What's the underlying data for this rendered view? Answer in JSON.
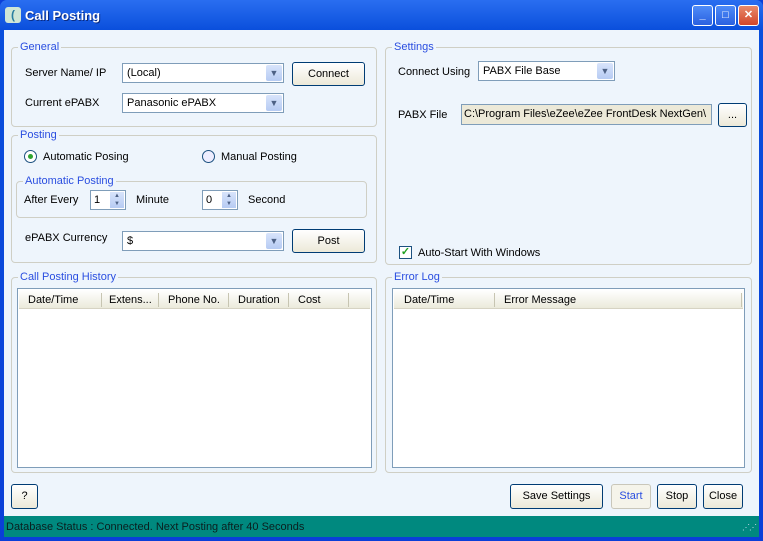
{
  "window": {
    "title": "Call Posting",
    "app_icon": "phone-wave-icon"
  },
  "general": {
    "legend": "General",
    "server_label": "Server Name/ IP",
    "server_value": "(Local)",
    "connect_label": "Connect",
    "epabx_label": "Current ePABX",
    "epabx_value": "Panasonic ePABX"
  },
  "posting": {
    "legend": "Posting",
    "auto_label": "Automatic Posing",
    "manual_label": "Manual Posting",
    "selected": "auto",
    "auto_group": {
      "legend": "Automatic Posting",
      "after_label": "After Every",
      "minute_value": "1",
      "minute_label": "Minute",
      "second_value": "0",
      "second_label": "Second"
    },
    "currency_label": "ePABX Currency",
    "currency_value": "$",
    "post_label": "Post"
  },
  "settings": {
    "legend": "Settings",
    "connect_using_label": "Connect Using",
    "connect_using_value": "PABX File Base",
    "pabx_file_label": "PABX File",
    "pabx_file_value": "C:\\Program Files\\eZee\\eZee FrontDesk NextGen\\",
    "browse_label": "...",
    "autostart_label": "Auto-Start With Windows",
    "autostart_checked": true
  },
  "history": {
    "legend": "Call Posting History",
    "columns": [
      "Date/Time",
      "Extens...",
      "Phone No.",
      "Duration",
      "Cost"
    ],
    "rows": []
  },
  "errorlog": {
    "legend": "Error Log",
    "columns": [
      "Date/Time",
      "Error Message"
    ],
    "rows": []
  },
  "footer": {
    "help_label": "?",
    "save_label": "Save Settings",
    "start_label": "Start",
    "stop_label": "Stop",
    "close_label": "Close"
  },
  "status": {
    "text": "Database Status : Connected. Next Posting after 40 Seconds"
  },
  "colors": {
    "title_bar": "#0a4fdc",
    "status_bar": "#00897f",
    "legend": "#2a4ee0"
  }
}
